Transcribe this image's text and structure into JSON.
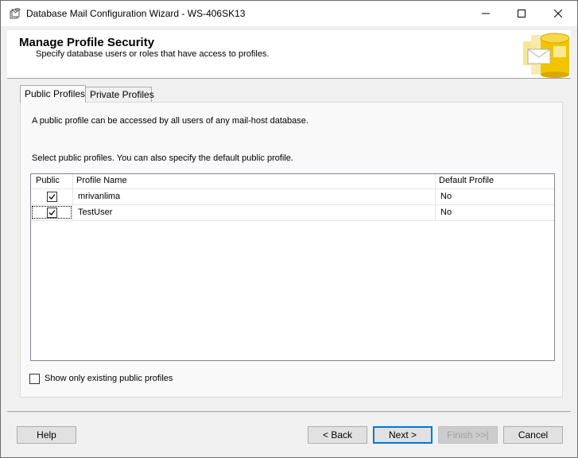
{
  "window": {
    "title": "Database Mail Configuration Wizard - WS-406SK13",
    "icons": {
      "app": "database-mail-icon",
      "minimize": "minimize-icon",
      "maximize": "maximize-icon",
      "close": "close-icon"
    }
  },
  "header": {
    "title": "Manage Profile Security",
    "subtitle": "Specify database users or roles that have access to profiles.",
    "art_icon": "database-cylinder-icon"
  },
  "tabs": [
    {
      "label": "Public Profiles",
      "active": true
    },
    {
      "label": "Private Profiles",
      "active": false
    }
  ],
  "panel": {
    "description": "A public profile can be accessed by all users of any mail-host database.",
    "instruction": "Select public profiles. You can also specify the default public profile.",
    "columns": [
      "Public",
      "Profile Name",
      "Default Profile"
    ],
    "rows": [
      {
        "public": true,
        "profile_name": "mrivanlima",
        "default_profile": "No"
      },
      {
        "public": true,
        "profile_name": "TestUser",
        "default_profile": "No"
      }
    ],
    "show_only_label": "Show only existing public profiles",
    "show_only_checked": false
  },
  "buttons": {
    "help": "Help",
    "back": "< Back",
    "next": "Next >",
    "finish": "Finish >>|",
    "cancel": "Cancel"
  },
  "colors": {
    "accent": "#0078d7",
    "header_art": "#f2c400"
  }
}
